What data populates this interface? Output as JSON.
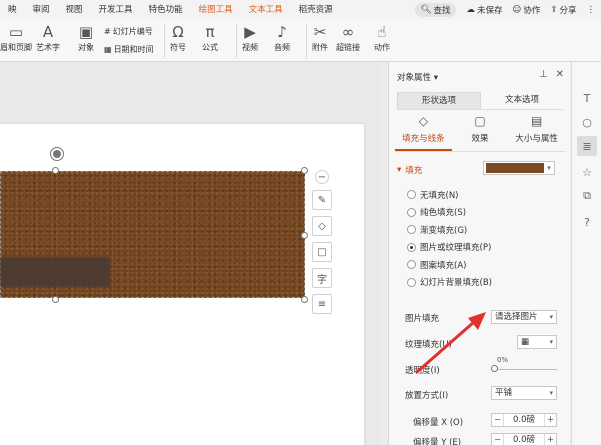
{
  "tabs": [
    "映",
    "审阅",
    "视图",
    "开发工具",
    "特色功能",
    "绘图工具",
    "文本工具",
    "稻壳资源"
  ],
  "topbar": {
    "search": "查找",
    "unsaved": "未保存",
    "collab": "协作",
    "share": "分享"
  },
  "ribbon": {
    "header_footer": "眉和页脚",
    "art_text": "艺术字",
    "object": "对象",
    "slide_number": "幻灯片编号",
    "date_time": "日期和时间",
    "symbol": "符号",
    "formula": "公式",
    "video": "视频",
    "audio": "音频",
    "attachment": "附件",
    "hyperlink": "超链接",
    "action": "动作"
  },
  "panel": {
    "title": "对象属性",
    "tab_shape": "形状选项",
    "tab_text": "文本选项",
    "itab_fill": "填充与线条",
    "itab_effect": "效果",
    "itab_size": "大小与属性",
    "fill_section": "填充",
    "radios": [
      {
        "label": "无填充(N)",
        "checked": false
      },
      {
        "label": "纯色填充(S)",
        "checked": false
      },
      {
        "label": "渐变填充(G)",
        "checked": false
      },
      {
        "label": "图片或纹理填充(P)",
        "checked": true
      },
      {
        "label": "图案填充(A)",
        "checked": false
      },
      {
        "label": "幻灯片背景填充(B)",
        "checked": false
      }
    ],
    "picture_fill_label": "图片填充",
    "picture_fill_value": "请选择图片",
    "texture_fill_label": "纹理填充(U)",
    "transparency_label": "透明度(I)",
    "transparency_value": "0%",
    "tile_label": "放置方式(I)",
    "tile_value": "平铺",
    "offset_x_label": "偏移量 X (O)",
    "offset_x_value": "0.0磅",
    "offset_y_label": "偏移量 Y (E)",
    "offset_y_value": "0.0磅"
  },
  "colors": {
    "accent": "#c64a14",
    "texture": "#7a4a22",
    "arrow": "#e03030"
  }
}
